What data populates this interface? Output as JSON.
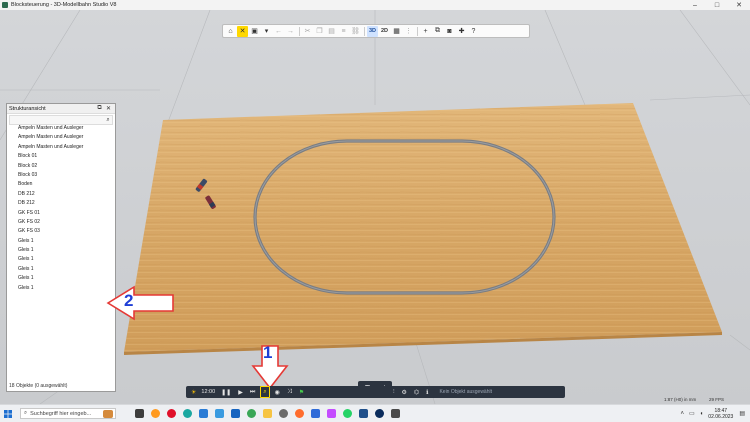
{
  "window": {
    "title": "Blocksteuerung - 3D-Modellbahn Studio V8",
    "controls": [
      "minimize-icon",
      "maximize-icon",
      "close-icon"
    ]
  },
  "toolbar": {
    "view_2d_3d_label": "3D",
    "view_2d_label": "2D",
    "icons": [
      "home-icon",
      "tools-icon",
      "save-icon",
      "undo-icon",
      "redo-icon",
      "cut-icon",
      "copy-icon",
      "paste-icon",
      "delete-icon",
      "link-icon",
      "grid-icon",
      "layers-icon",
      "add-icon",
      "duplicate-icon",
      "camera-icon",
      "puzzle-icon",
      "help-icon"
    ]
  },
  "structure_panel": {
    "title": "Strukturansicht",
    "search_placeholder": "",
    "items": [
      "Ampeln Masten und Ausleger",
      "Ampeln Masten und Ausleger",
      "Ampeln Masten und Ausleger",
      "Block 01",
      "Block 02",
      "Block 03",
      "Boden",
      "DB 212",
      "DB 212",
      "GK FS 01",
      "GK FS 02",
      "GK FS 03",
      "Gleis 1",
      "Gleis 1",
      "Gleis 1",
      "Gleis 1",
      "Gleis 1",
      "Gleis 1"
    ],
    "footer": "18 Objekte (0 ausgewählt)"
  },
  "annotations": {
    "arrow_1_label": "1",
    "arrow_2_label": "2"
  },
  "bottom_bar": {
    "time": "12:00",
    "status": "Kein Objekt ausgewählt",
    "scale": "1:87 (H0) in mm",
    "fps": "29 FPS"
  },
  "taskbar": {
    "search_placeholder": "Suchbegriff hier eingeb...",
    "clock_time": "18:47",
    "clock_date": "02.06.2023"
  },
  "colors": {
    "board": "#d9a865",
    "track": "#7a7d82",
    "annotation_red": "#e53935",
    "annotation_blue": "#1f3fd6",
    "highlight": "#ffd800"
  }
}
